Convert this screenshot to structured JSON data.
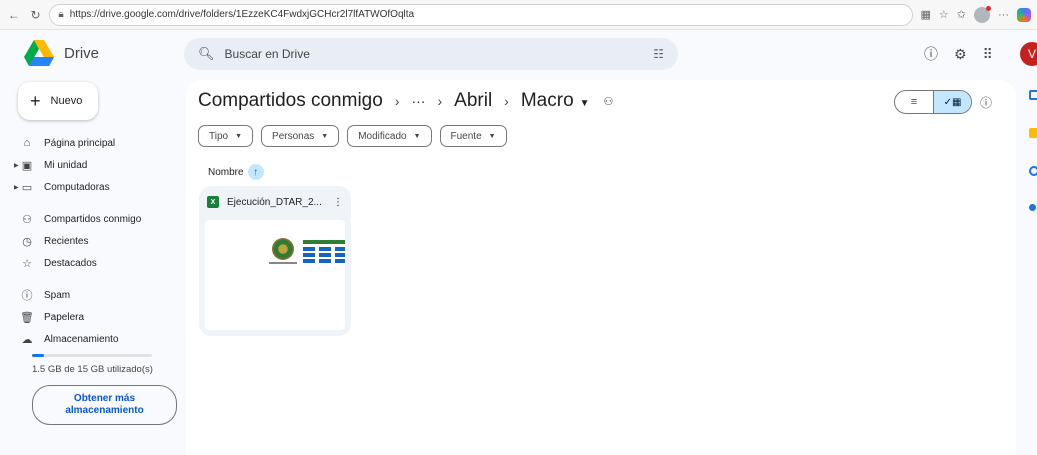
{
  "browser": {
    "url": "https://drive.google.com/drive/folders/1EzzeKC4FwdxjGCHcr2l7lfATWOfOqlta"
  },
  "app": {
    "name": "Drive",
    "user_initial": "V"
  },
  "search": {
    "placeholder": "Buscar en Drive"
  },
  "sidebar": {
    "new_label": "Nuevo",
    "items": [
      {
        "label": "Página principal",
        "icon": "home-icon"
      },
      {
        "label": "Mi unidad",
        "icon": "my-drive-icon"
      },
      {
        "label": "Computadoras",
        "icon": "computer-icon"
      },
      {
        "label": "Compartidos conmigo",
        "icon": "shared-icon"
      },
      {
        "label": "Recientes",
        "icon": "clock-icon"
      },
      {
        "label": "Destacados",
        "icon": "star-icon"
      },
      {
        "label": "Spam",
        "icon": "spam-icon"
      },
      {
        "label": "Papelera",
        "icon": "trash-icon"
      },
      {
        "label": "Almacenamiento",
        "icon": "cloud-icon"
      }
    ],
    "storage": {
      "text": "1.5 GB de 15 GB utilizado(s)",
      "used_fraction": 0.1
    },
    "more_storage_label": "Obtener más almacenamiento"
  },
  "breadcrumb": {
    "root": "Compartidos conmigo",
    "ellipsis": "···",
    "parent": "Abril",
    "current": "Macro"
  },
  "filters": {
    "type": "Tipo",
    "people": "Personas",
    "modified": "Modificado",
    "source": "Fuente"
  },
  "sort": {
    "label": "Nombre"
  },
  "files": [
    {
      "name": "Ejecución_DTAR_2...",
      "type": "excel-icon"
    }
  ],
  "colors": {
    "accent": "#0b57d0",
    "selected": "#c2e7ff",
    "avatar": "#c5221f",
    "excel": "#188038"
  }
}
